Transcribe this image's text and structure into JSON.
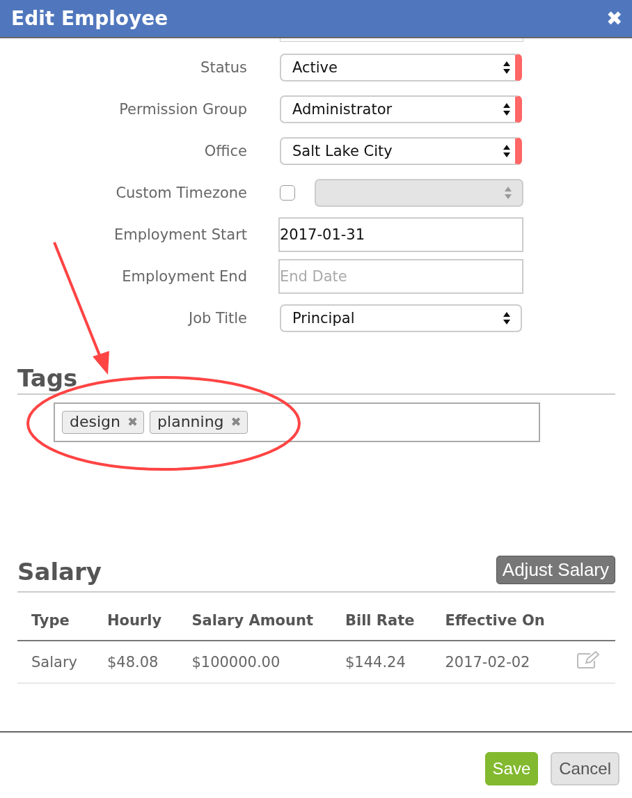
{
  "window": {
    "title": "Edit Employee",
    "close": "✖"
  },
  "fields": [
    {
      "kind": "select",
      "label": "Status",
      "value": "Active",
      "required": true
    },
    {
      "kind": "select",
      "label": "Permission Group",
      "value": "Administrator",
      "required": true
    },
    {
      "kind": "select",
      "label": "Office",
      "value": "Salt Lake City",
      "required": true
    },
    {
      "kind": "checkbox-select",
      "label": "Custom Timezone",
      "checked": false,
      "disabled": true
    },
    {
      "kind": "text",
      "label": "Employment Start",
      "value": "2017-01-31"
    },
    {
      "kind": "text",
      "label": "Employment End",
      "placeholder": "End Date"
    },
    {
      "kind": "select",
      "label": "Job Title",
      "value": "Principal",
      "required": false
    }
  ],
  "tags": {
    "title": "Tags",
    "items": [
      {
        "label": "design",
        "remove": "✖"
      },
      {
        "label": "planning",
        "remove": "✖"
      }
    ]
  },
  "salary": {
    "title": "Salary",
    "adjust_button": "Adjust Salary",
    "table": {
      "columns": [
        "Type",
        "Hourly",
        "Salary Amount",
        "Bill Rate",
        "Effective On"
      ],
      "rows": [
        {
          "cells": [
            "Salary",
            "$48.08",
            "$100000.00",
            "$144.24",
            "2017-02-02"
          ]
        }
      ]
    }
  },
  "buttons": [
    {
      "label": "Save",
      "kind": "primary"
    },
    {
      "label": "Cancel",
      "kind": "secondary"
    }
  ]
}
